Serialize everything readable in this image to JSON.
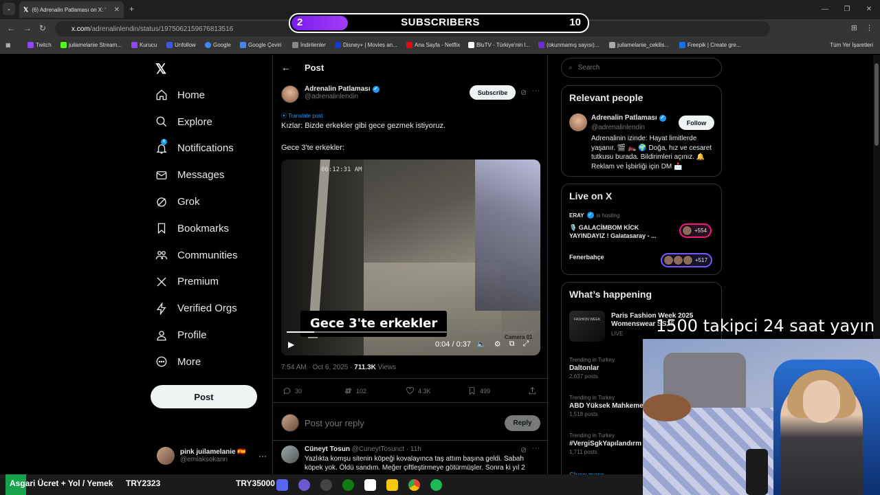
{
  "browser": {
    "tab_title": "(6) Adrenalin Patlaması on X: \"K",
    "url_host": "x.com",
    "url_path": "/adrenalinlendin/status/1975062159676813516",
    "bookmarks": [
      "Twitch",
      "juilamelanie Stream...",
      "Kurucu",
      "Unfollow",
      "Google",
      "Google Çeviri",
      "İndirilenler",
      "Disney+ | Movies an...",
      "Ana Sayfa - Netflix",
      "BluTV - Türkiye'nin l...",
      "(okunmamış sayısı)...",
      "juilamelanie_cekilis...",
      "Freepik | Create gre..."
    ],
    "all_bookmarks": "Tüm Yer İşaretleri"
  },
  "sub_goal": {
    "current": "2",
    "label": "SUBSCRIBERS",
    "goal": "10",
    "progress": 0.2
  },
  "nav": {
    "items": [
      "Home",
      "Explore",
      "Notifications",
      "Messages",
      "Grok",
      "Bookmarks",
      "Communities",
      "Premium",
      "Verified Orgs",
      "Profile",
      "More"
    ],
    "notif_count": "6",
    "post_label": "Post",
    "me_name": "pink juilamelanie 🇪🇸",
    "me_handle": "@emlaksokann"
  },
  "post": {
    "header": "Post",
    "author_name": "Adrenalin Patlaması",
    "author_handle": "@adrenalinlendin",
    "subscribe": "Subscribe",
    "translate": "Translate post",
    "line1": "Kızlar: Bizde erkekler gibi gece gezmek istiyoruz.",
    "line2": "Gece 3'te erkekler:",
    "video_timestamp": "06:12:31 AM",
    "video_caption": "Gece 3'te erkekler",
    "video_time": "0:04 / 0:37",
    "video_progress": 0.11,
    "camera_label": "Camera 01",
    "meta_time": "7:54 AM · Oct 6, 2025 · ",
    "views": "711.3K",
    "views_label": " Views",
    "replies": "30",
    "reposts": "102",
    "likes": "4.3K",
    "bookmarks": "499",
    "reply_placeholder": "Post your reply",
    "reply_btn": "Reply"
  },
  "reply_tweet": {
    "name": "Cüneyt Tosun",
    "handle_time": " @CuneytTosunct · 11h",
    "text": "Yazlıkta komşu sitenin köpeği kovalayınca taş attım başına geldi. Sabah köpek yok. Öldü sandım. Meğer çiftleştirmeye götürmüşler. Sonra ki yıl 2"
  },
  "right": {
    "search_placeholder": "Search",
    "relevant_title": "Relevant people",
    "rp_name": "Adrenalin Patlaması",
    "rp_handle": "@adrenalinlendin",
    "follow": "Follow",
    "rp_bio": "Adrenalinin izinde: Hayat limitlerde yaşanır. 🎬 🏍️ 🌍 Doğa, hız ve cesaret tutkusu burada. Bildirimleri açınız. 🔔 Reklam ve İşbirliği için DM 📩",
    "live_title": "Live on X",
    "live_host": "ERAY",
    "live_hosting": "is hosting",
    "live_stream1": "🎙️ GALACİMBOM KİCK YAYINDAYIZ ! Galatasaray - ...",
    "live_count1": "+554",
    "live_stream2": "Fenerbahçe",
    "live_count2": "+517",
    "happening_title": "What’s happening",
    "fw_img_text": "FASHION WEEK",
    "fw_title": "Paris Fashion Week 2025 Womenswear SS26",
    "fw_live": "LIVE",
    "trends": [
      {
        "context": "Trending in Turkey",
        "name": "Daltonlar",
        "count": "2,637 posts"
      },
      {
        "context": "Trending in Turkey",
        "name": "ABD Yüksek Mahkeme",
        "count": "1,518 posts"
      },
      {
        "context": "Trending in Turkey",
        "name": "#VergiSgkYapılandırm",
        "count": "1,711 posts"
      }
    ],
    "show_more": "Show more"
  },
  "overlay": {
    "follower_goal": "1500 takipci 24 saat yayın",
    "ticker_label": "Asgari Ücret + Yol / Yemek",
    "ticker_value1": "TRY2323",
    "ticker_value2": "TRY35000"
  }
}
